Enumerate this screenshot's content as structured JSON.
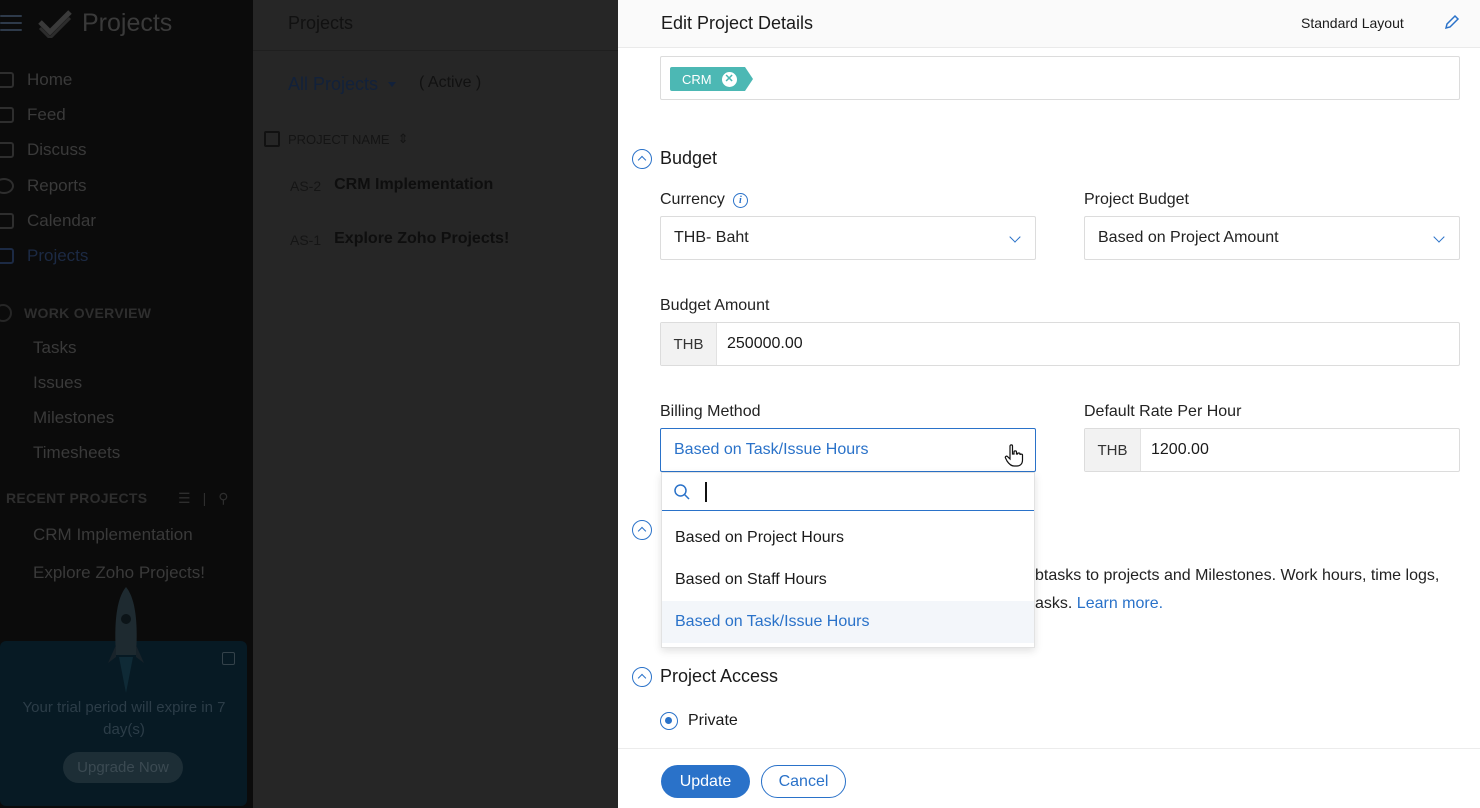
{
  "sidebar": {
    "brand_title": "Projects",
    "nav": [
      {
        "label": "Home"
      },
      {
        "label": "Feed"
      },
      {
        "label": "Discuss"
      },
      {
        "label": "Reports"
      },
      {
        "label": "Calendar"
      },
      {
        "label": "Projects"
      }
    ],
    "work_overview": {
      "heading": "WORK OVERVIEW",
      "items": [
        "Tasks",
        "Issues",
        "Milestones",
        "Timesheets"
      ]
    },
    "recent": {
      "heading": "RECENT PROJECTS",
      "items": [
        "CRM Implementation",
        "Explore Zoho Projects!"
      ]
    },
    "trial": {
      "text": "Your trial period will expire in 7 day(s)",
      "button": "Upgrade Now"
    }
  },
  "list": {
    "title": "Projects",
    "filter": "All Projects",
    "status": "( Active )",
    "column_header": "PROJECT NAME",
    "rows": [
      {
        "key": "AS-2",
        "name": "CRM Implementation"
      },
      {
        "key": "AS-1",
        "name": "Explore Zoho Projects!"
      }
    ]
  },
  "panel": {
    "title": "Edit Project Details",
    "layout": "Standard Layout",
    "tag": "CRM",
    "budget": {
      "heading": "Budget",
      "currency_label": "Currency",
      "currency_value": "THB- Baht",
      "project_budget_label": "Project Budget",
      "project_budget_value": "Based on Project Amount",
      "budget_amount_label": "Budget Amount",
      "budget_amount_prefix": "THB",
      "budget_amount_value": "250000.00",
      "billing_method_label": "Billing Method",
      "billing_method_value": "Based on Task/Issue Hours",
      "rate_label": "Default Rate Per Hour",
      "rate_prefix": "THB",
      "rate_value": "1200.00"
    },
    "desc_line1": "btasks to projects and Milestones. Work hours, time logs,",
    "desc_line2": "asks.",
    "learn_more": "Learn more.",
    "access": {
      "heading": "Project Access",
      "option": "Private"
    },
    "footer": {
      "update": "Update",
      "cancel": "Cancel"
    }
  },
  "dropdown": {
    "search_value": "",
    "options": [
      {
        "label": "Based on Project Hours",
        "selected": false
      },
      {
        "label": "Based on Staff Hours",
        "selected": false
      },
      {
        "label": "Based on Task/Issue Hours",
        "selected": true
      }
    ]
  },
  "colors": {
    "accent": "#2a72c9",
    "tag": "#4cb8b4"
  }
}
